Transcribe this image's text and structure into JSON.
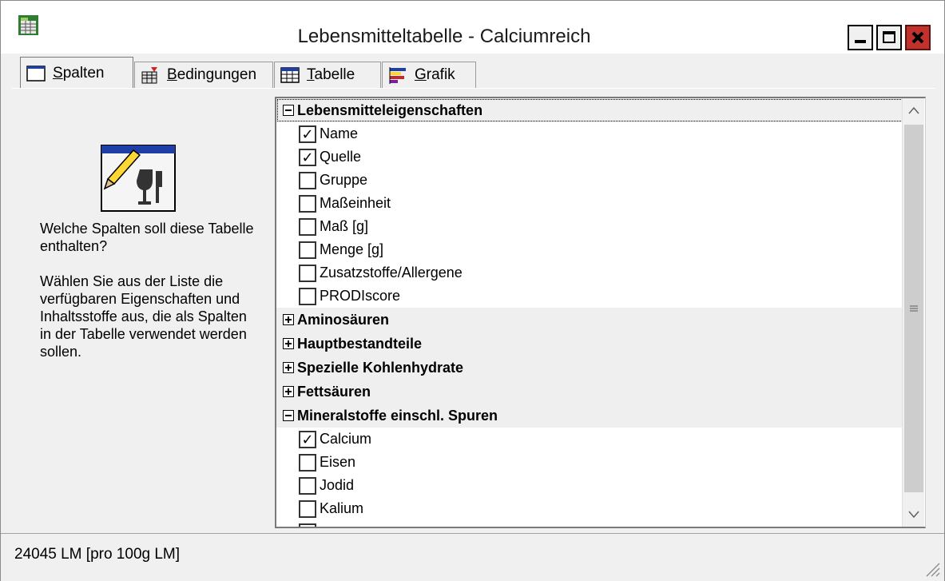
{
  "window": {
    "title": "Lebensmitteltabelle - Calciumreich"
  },
  "tabs": [
    {
      "label": "Spalten",
      "icon": "window-icon",
      "active": true
    },
    {
      "label": "Bedingungen",
      "icon": "conditions-icon",
      "active": false
    },
    {
      "label": "Tabelle",
      "icon": "table-icon",
      "active": false
    },
    {
      "label": "Grafik",
      "icon": "chart-icon",
      "active": false
    }
  ],
  "help": {
    "question": "Welche Spalten soll diese Tabelle enthalten?",
    "instruction": "Wählen Sie aus der Liste die verfügbaren Eigenschaften und Inhaltsstoffe aus, die als Spalten in der Tabelle verwendet werden sollen."
  },
  "tree": {
    "groups": [
      {
        "label": "Lebensmitteleigenschaften",
        "expanded": true,
        "items": [
          {
            "label": "Name",
            "checked": true
          },
          {
            "label": "Quelle",
            "checked": true
          },
          {
            "label": "Gruppe",
            "checked": false
          },
          {
            "label": "Maßeinheit",
            "checked": false
          },
          {
            "label": "Maß [g]",
            "checked": false
          },
          {
            "label": "Menge [g]",
            "checked": false
          },
          {
            "label": "Zusatzstoffe/Allergene",
            "checked": false
          },
          {
            "label": "PRODIscore",
            "checked": false
          }
        ]
      },
      {
        "label": "Aminosäuren",
        "expanded": false,
        "items": []
      },
      {
        "label": "Hauptbestandteile",
        "expanded": false,
        "items": []
      },
      {
        "label": "Spezielle Kohlenhydrate",
        "expanded": false,
        "items": []
      },
      {
        "label": "Fettsäuren",
        "expanded": false,
        "items": []
      },
      {
        "label": "Mineralstoffe einschl. Spuren",
        "expanded": true,
        "items": [
          {
            "label": "Calcium",
            "checked": true
          },
          {
            "label": "Eisen",
            "checked": false
          },
          {
            "label": "Jodid",
            "checked": false
          },
          {
            "label": "Kalium",
            "checked": false
          }
        ]
      }
    ]
  },
  "status": {
    "text": "24045 LM [pro 100g LM]"
  },
  "colors": {
    "close_button": "#c1322c",
    "group_row": "#efefef",
    "window_bg": "#f0f0f0"
  }
}
